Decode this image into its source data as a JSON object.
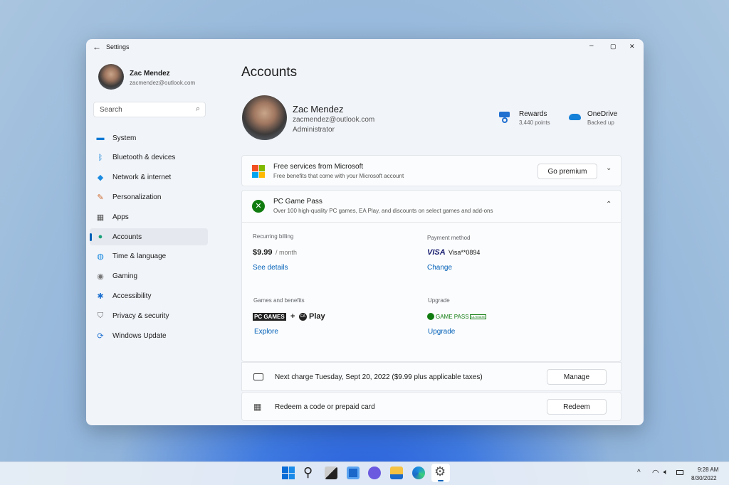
{
  "window": {
    "title": "Settings",
    "back": "←",
    "min": "–",
    "max": "▢",
    "close": "✕"
  },
  "user": {
    "name": "Zac Mendez",
    "email": "zacmendez@outlook.com",
    "role": "Administrator"
  },
  "search": {
    "placeholder": "Search"
  },
  "sidebar": {
    "items": [
      {
        "label": "System",
        "icon": "monitor-icon",
        "glyph": "▬",
        "color": "#0078d4"
      },
      {
        "label": "Bluetooth & devices",
        "icon": "bluetooth-icon",
        "glyph": "ᛒ",
        "color": "#0078d4"
      },
      {
        "label": "Network & internet",
        "icon": "wifi-icon",
        "glyph": "◆",
        "color": "#1a8be0"
      },
      {
        "label": "Personalization",
        "icon": "brush-icon",
        "glyph": "✎",
        "color": "#d06a2c"
      },
      {
        "label": "Apps",
        "icon": "apps-icon",
        "glyph": "▦",
        "color": "#555"
      },
      {
        "label": "Accounts",
        "icon": "person-icon",
        "glyph": "●",
        "color": "#1aa07a",
        "selected": true
      },
      {
        "label": "Time & language",
        "icon": "globe-clock-icon",
        "glyph": "◍",
        "color": "#1a8be0"
      },
      {
        "label": "Gaming",
        "icon": "gamepad-icon",
        "glyph": "◉",
        "color": "#777"
      },
      {
        "label": "Accessibility",
        "icon": "accessibility-icon",
        "glyph": "✱",
        "color": "#1a6fd0"
      },
      {
        "label": "Privacy & security",
        "icon": "shield-icon",
        "glyph": "⛉",
        "color": "#666"
      },
      {
        "label": "Windows Update",
        "icon": "update-icon",
        "glyph": "⟳",
        "color": "#1a6fd0"
      }
    ]
  },
  "main": {
    "title": "Accounts",
    "rewards": {
      "label": "Rewards",
      "value": "3,440 points"
    },
    "onedrive": {
      "label": "OneDrive",
      "value": "Backed up"
    },
    "free_services": {
      "title": "Free services from Microsoft",
      "subtitle": "Free benefits that come with your Microsoft account",
      "button": "Go premium"
    },
    "gamepass": {
      "title": "PC Game Pass",
      "subtitle": "Over 100 high-quality PC games, EA Play, and discounts on select games and add-ons",
      "billing_label": "Recurring billing",
      "price": "$9.99",
      "period": "/ month",
      "see_details": "See details",
      "payment_label": "Payment method",
      "visa_logo": "VISA",
      "card": "Visa**0894",
      "change": "Change",
      "games_label": "Games and benefits",
      "pc_games": "PC GAMES",
      "plus": "+",
      "ea": "EA",
      "play": "Play",
      "explore": "Explore",
      "upgrade_label": "Upgrade",
      "gamepass_logo": "GAME PASS",
      "ultimate": "ULTIMATE",
      "upgrade": "Upgrade"
    },
    "next_charge": {
      "text": "Next charge Tuesday, Sept 20, 2022 ($9.99 plus applicable taxes)",
      "button": "Manage"
    },
    "redeem": {
      "text": "Redeem a code or prepaid card",
      "button": "Redeem"
    }
  },
  "taskbar": {
    "time": "9:28 AM",
    "date": "8/30/2022",
    "chevron": "^"
  }
}
